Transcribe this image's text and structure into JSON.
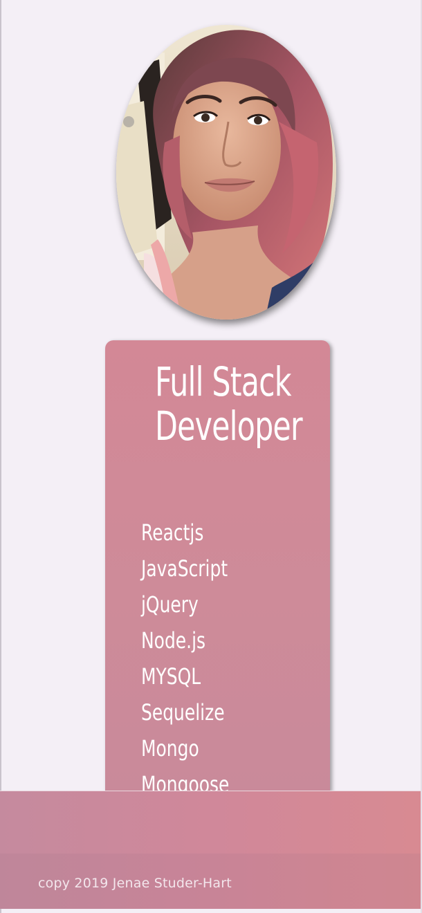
{
  "profile": {
    "photo_alt": "Profile photo"
  },
  "card": {
    "title_line1": "Full Stack",
    "title_line2": "Developer",
    "skills": [
      "Reactjs",
      "JavaScript",
      "jQuery",
      "Node.js",
      "MYSQL",
      "Sequelize",
      "Mongo",
      "Mongoose"
    ]
  },
  "footer": {
    "copyright": "copy 2019 Jenae Studer-Hart"
  },
  "colors": {
    "background": "#f4eff6",
    "card": "#d08896",
    "footer": "#cf8a9a",
    "text": "#ffffff"
  }
}
